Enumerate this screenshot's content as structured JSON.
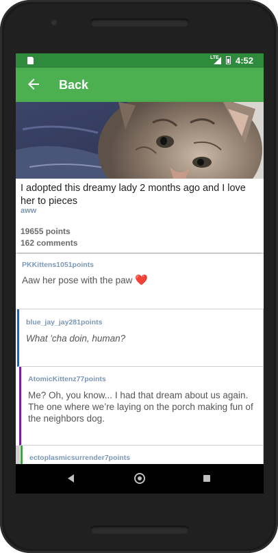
{
  "status_bar": {
    "network": "LTE",
    "time": "4:52",
    "icons": [
      "sd-card-icon",
      "signal-icon",
      "battery-icon"
    ]
  },
  "app_bar": {
    "back_icon": "arrow-left-icon",
    "title": "Back"
  },
  "post": {
    "image": "kitten-photo",
    "title": "I adopted this dreamy lady 2 months ago and I love her to pieces",
    "subreddit": "aww",
    "points": "19655 points",
    "comments": "162 comments"
  },
  "comments": [
    {
      "author_line": "PKKittens1051points",
      "body": "Aaw her pose with the paw",
      "emoji": "❤️",
      "thread_color": ""
    },
    {
      "author_line": "blue_jay_jay281points",
      "body": "What 'cha doin, human?",
      "thread_color": "#1565c0"
    },
    {
      "author_line": "AtomicKittenz77points",
      "body": "Me? Oh, you know... I had that dream about us again. The one where we’re laying on the porch making fun of the neighbors dog.",
      "thread_color": "#7b1fa2"
    },
    {
      "author_line": "ectoplasmicsurrender7points",
      "body": "",
      "thread_color": "#43a047"
    }
  ],
  "nav_bar": {
    "icons": [
      "nav-back-icon",
      "nav-home-icon",
      "nav-recents-icon"
    ]
  },
  "colors": {
    "accent": "#4caf50",
    "status_bar": "#2e8b3b",
    "author": "#7c98b6"
  }
}
